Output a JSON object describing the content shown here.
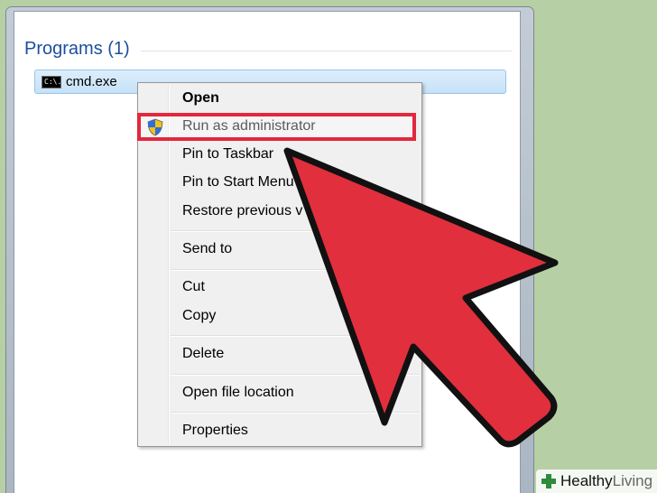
{
  "section": {
    "title": "Programs (1)"
  },
  "result": {
    "icon": "command-prompt-icon",
    "icon_text": "C:\\.",
    "label": "cmd.exe"
  },
  "context_menu": {
    "items": [
      {
        "label": "Open",
        "bold": true
      },
      {
        "label": "Run as administrator",
        "icon": "uac-shield-icon",
        "highlighted": true
      },
      {
        "label": "Pin to Taskbar"
      },
      {
        "label": "Pin to Start Menu"
      },
      {
        "label": "Restore previous v"
      },
      {
        "label": "Send to"
      },
      {
        "label": "Cut"
      },
      {
        "label": "Copy"
      },
      {
        "label": "Delete"
      },
      {
        "label": "Open file location"
      },
      {
        "label": "Properties"
      }
    ]
  },
  "watermark": {
    "brand_bold": "Healthy",
    "brand_light": "Living"
  },
  "colors": {
    "background": "#b7cfa5",
    "highlight": "#e3273d",
    "arrow_fill": "#e12f3e",
    "title_blue": "#1b4f9e"
  }
}
